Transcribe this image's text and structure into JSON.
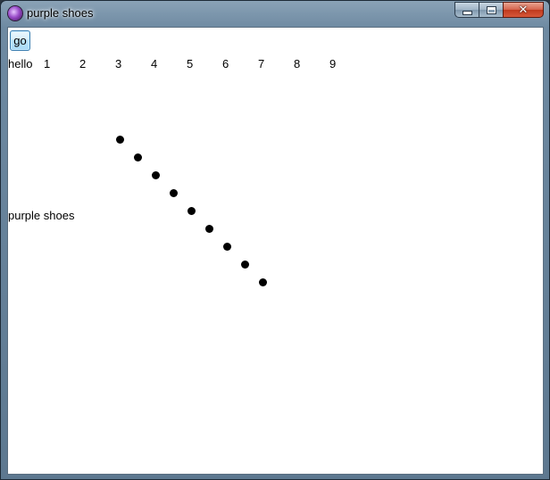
{
  "window": {
    "title": "purple shoes",
    "icon": "purple-shoes-app-icon",
    "caption_buttons": [
      "minimize",
      "maximize",
      "close"
    ]
  },
  "toolbar": {
    "go_label": "go"
  },
  "content": {
    "hello_label": "hello",
    "numbers": [
      "1",
      "2",
      "3",
      "4",
      "5",
      "6",
      "7",
      "8",
      "9"
    ],
    "footer_label": "purple shoes",
    "dot_count": 9
  },
  "colors": {
    "dot": "#000000",
    "background": "#ffffff"
  }
}
